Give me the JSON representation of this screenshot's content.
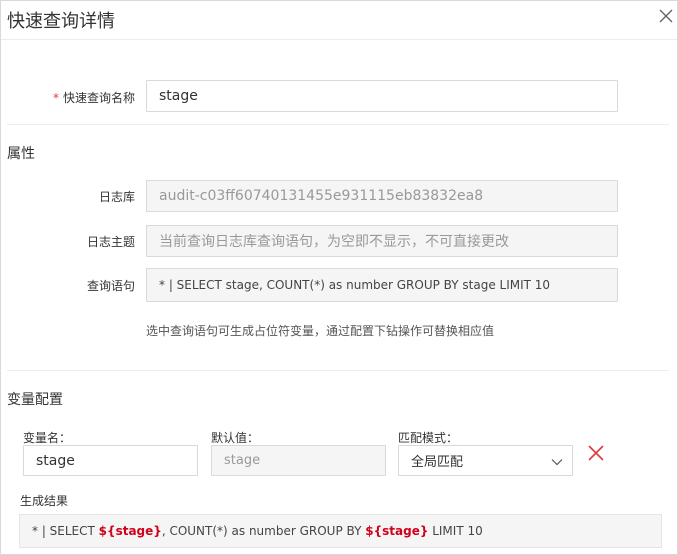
{
  "dialog": {
    "title": "快速查询详情",
    "close_icon": "close-icon"
  },
  "form": {
    "name_required_mark": "*",
    "name_label": "快速查询名称",
    "name_value": "stage"
  },
  "attributes": {
    "section_title": "属性",
    "logstore_label": "日志库",
    "logstore_value": "audit-c03ff60740131455e931115eb83832ea8",
    "topic_label": "日志主题",
    "topic_placeholder": "当前查询日志库查询语句，为空即不显示，不可直接更改",
    "query_label": "查询语句",
    "query_value": "* | SELECT stage, COUNT(*) as number GROUP BY stage LIMIT 10",
    "hint": "选中查询语句可生成占位符变量，通过配置下钻操作可替换相应值"
  },
  "variables": {
    "section_title": "变量配置",
    "name_label": "变量名：",
    "name_value": "stage",
    "default_label": "默认值：",
    "default_placeholder": "stage",
    "mode_label": "匹配模式：",
    "mode_value": "全局匹配",
    "delete_icon": "delete-icon",
    "delete_color": "#e4393c",
    "result_label": "生成结果",
    "result_parts": {
      "p1": "* | SELECT ",
      "v1": "${stage}",
      "p2": ", COUNT(*) as number GROUP BY ",
      "v2": "${stage}",
      "p3": " LIMIT 10"
    }
  }
}
